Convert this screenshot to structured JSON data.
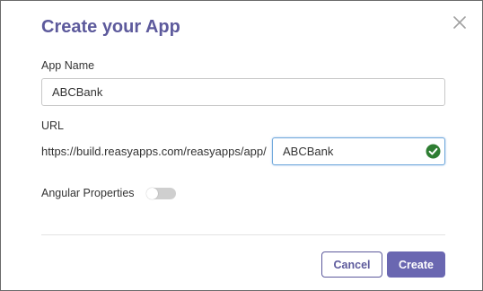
{
  "dialog": {
    "title": "Create your App",
    "close_icon": "close-icon"
  },
  "form": {
    "app_name_label": "App Name",
    "app_name_value": "ABCBank",
    "url_label": "URL",
    "url_prefix": "https://build.reasyapps.com/reasyapps/app/",
    "url_value": "ABCBank",
    "url_valid_icon": "check-circle-icon",
    "angular_label": "Angular Properties",
    "angular_enabled": false
  },
  "footer": {
    "cancel_label": "Cancel",
    "create_label": "Create"
  },
  "colors": {
    "accent": "#6a67b1",
    "title": "#5d5a9c",
    "valid": "#2e7d32"
  }
}
